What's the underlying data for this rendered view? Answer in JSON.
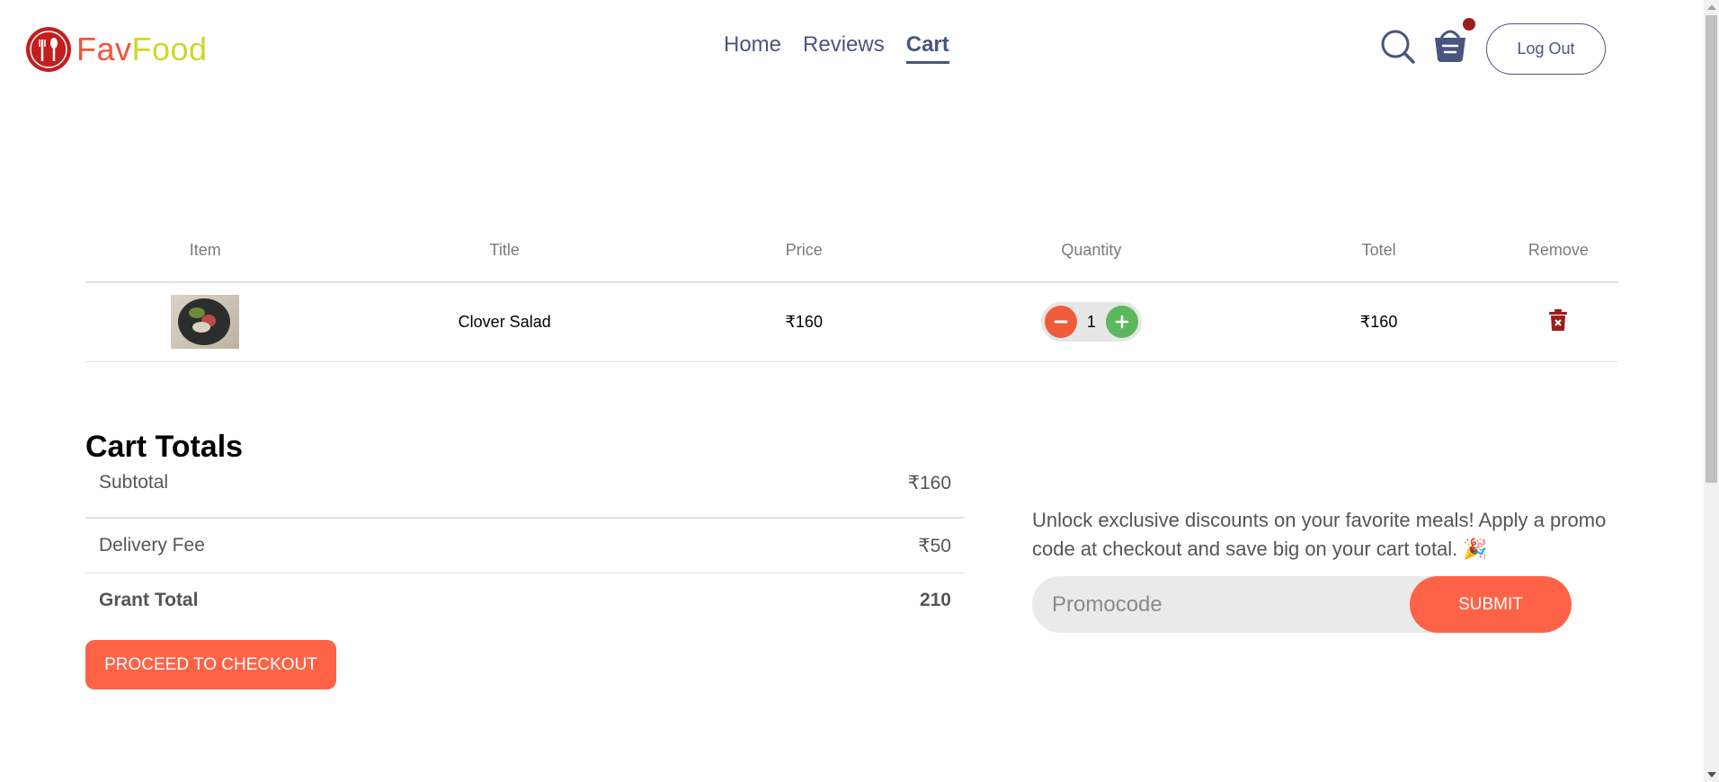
{
  "brand": {
    "part1": "Fav",
    "part2": "Food",
    "accent": "#f0543c",
    "accent2": "#cfd62a"
  },
  "nav": {
    "items": [
      {
        "label": "Home"
      },
      {
        "label": "Reviews"
      },
      {
        "label": "Cart"
      }
    ],
    "active": "Cart",
    "logout_label": "Log Out"
  },
  "cart": {
    "headers": [
      "Item",
      "Title",
      "Price",
      "Quantity",
      "Totel",
      "Remove"
    ],
    "items": [
      {
        "title": "Clover Salad",
        "price": "₹160",
        "quantity": "1",
        "total": "₹160"
      }
    ]
  },
  "totals": {
    "heading": "Cart Totals",
    "subtotal_label": "Subtotal",
    "subtotal_value": "₹160",
    "delivery_label": "Delivery Fee",
    "delivery_value": "₹50",
    "grand_label": "Grant Total",
    "grand_value": "210",
    "checkout_label": "PROCEED TO CHECKOUT"
  },
  "promo": {
    "text": "Unlock exclusive discounts on your favorite meals! Apply a promo code at checkout and save big on your cart total. 🎉",
    "placeholder": "Promocode",
    "submit_label": "SUBMIT"
  },
  "colors": {
    "primary": "#ff6347",
    "nav_text": "#49557e",
    "plus": "#5cb85c",
    "danger": "#9b1e1e"
  }
}
